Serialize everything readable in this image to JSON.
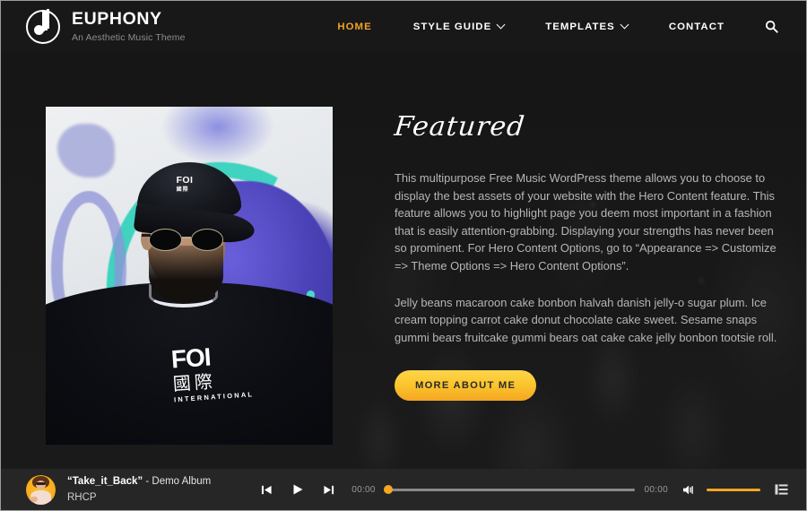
{
  "site": {
    "brand_title": "EUPHONY",
    "brand_tagline": "An Aesthetic Music Theme",
    "logo_icon": "music-note-circle-icon"
  },
  "nav": {
    "items": [
      {
        "label": "HOME",
        "active": true,
        "has_dropdown": false
      },
      {
        "label": "STYLE GUIDE",
        "active": false,
        "has_dropdown": true
      },
      {
        "label": "TEMPLATES",
        "active": false,
        "has_dropdown": true
      },
      {
        "label": "CONTACT",
        "active": false,
        "has_dropdown": false
      }
    ],
    "search_icon": "search-icon",
    "active_color": "#f0a325"
  },
  "hero": {
    "image_alt": "Man wearing black FOI cap and round sunglasses in front of graffiti wall",
    "cap_text": "FOI",
    "cap_subtext": "國際",
    "shirt_text": "FOI",
    "shirt_cjk": "國際",
    "shirt_subtext": "INTERNATIONAL",
    "title": "Featured",
    "paragraph1": "This multipurpose Free Music WordPress theme allows you to choose to display the best assets of your website with the Hero Content feature. This feature allows you to highlight page you deem most important in a fashion that is easily attention-grabbing. Displaying your strengths has never been so prominent. For Hero Content Options, go to “Appearance => Customize => Theme Options => Hero Content Options”.",
    "paragraph2": "Jelly beans macaroon cake bonbon halvah danish jelly-o sugar plum. Ice cream topping carrot cake donut chocolate cake sweet. Sesame snaps gummi bears fruitcake gummi bears oat cake cake jelly bonbon tootsie roll.",
    "cta_label": "MORE ABOUT ME",
    "cta_color": "#f5a623"
  },
  "player": {
    "album_art_icon": "album-art-avatar",
    "track_title": "“Take_it_Back”",
    "track_album": " - Demo Album",
    "artist": "RHCP",
    "prev_icon": "previous-track-icon",
    "play_icon": "play-icon",
    "next_icon": "next-track-icon",
    "time_elapsed": "00:00",
    "time_total": "00:00",
    "progress_percent": 0,
    "volume_percent": 100,
    "volume_icon": "volume-speaker-icon",
    "playlist_icon": "playlist-list-icon",
    "accent_color": "#f5a623"
  }
}
